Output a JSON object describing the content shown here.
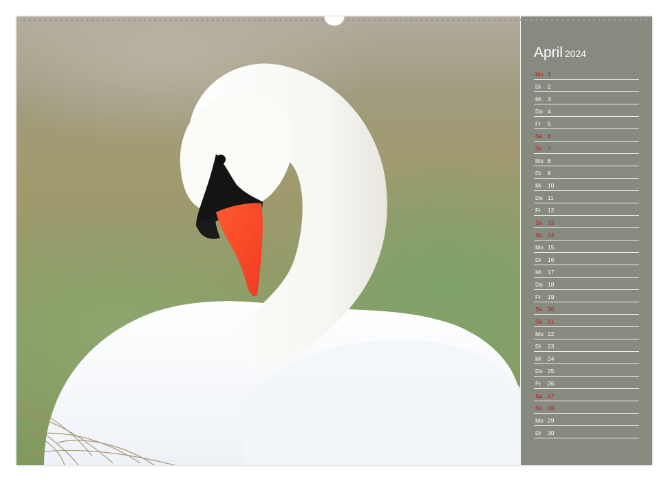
{
  "calendar": {
    "month": "April",
    "year": "2024",
    "accent_color": "#c4161c",
    "days": [
      {
        "wd": "Mo",
        "d": "1",
        "weekend": true
      },
      {
        "wd": "Di",
        "d": "2",
        "weekend": false
      },
      {
        "wd": "Mi",
        "d": "3",
        "weekend": false
      },
      {
        "wd": "Do",
        "d": "4",
        "weekend": false
      },
      {
        "wd": "Fr",
        "d": "5",
        "weekend": false
      },
      {
        "wd": "Sa",
        "d": "6",
        "weekend": true
      },
      {
        "wd": "So",
        "d": "7",
        "weekend": true
      },
      {
        "wd": "Mo",
        "d": "8",
        "weekend": false
      },
      {
        "wd": "Di",
        "d": "9",
        "weekend": false
      },
      {
        "wd": "Mi",
        "d": "10",
        "weekend": false
      },
      {
        "wd": "Do",
        "d": "11",
        "weekend": false
      },
      {
        "wd": "Fr",
        "d": "12",
        "weekend": false
      },
      {
        "wd": "Sa",
        "d": "13",
        "weekend": true
      },
      {
        "wd": "So",
        "d": "14",
        "weekend": true
      },
      {
        "wd": "Mo",
        "d": "15",
        "weekend": false
      },
      {
        "wd": "Di",
        "d": "16",
        "weekend": false
      },
      {
        "wd": "Mi",
        "d": "17",
        "weekend": false
      },
      {
        "wd": "Do",
        "d": "18",
        "weekend": false
      },
      {
        "wd": "Fr",
        "d": "19",
        "weekend": false
      },
      {
        "wd": "Sa",
        "d": "20",
        "weekend": true
      },
      {
        "wd": "So",
        "d": "21",
        "weekend": true
      },
      {
        "wd": "Mo",
        "d": "22",
        "weekend": false
      },
      {
        "wd": "Di",
        "d": "23",
        "weekend": false
      },
      {
        "wd": "Mi",
        "d": "24",
        "weekend": false
      },
      {
        "wd": "Do",
        "d": "25",
        "weekend": false
      },
      {
        "wd": "Fr",
        "d": "26",
        "weekend": false
      },
      {
        "wd": "Sa",
        "d": "27",
        "weekend": true
      },
      {
        "wd": "So",
        "d": "28",
        "weekend": true
      },
      {
        "wd": "Mo",
        "d": "29",
        "weekend": false
      },
      {
        "wd": "Di",
        "d": "30",
        "weekend": false
      }
    ]
  }
}
